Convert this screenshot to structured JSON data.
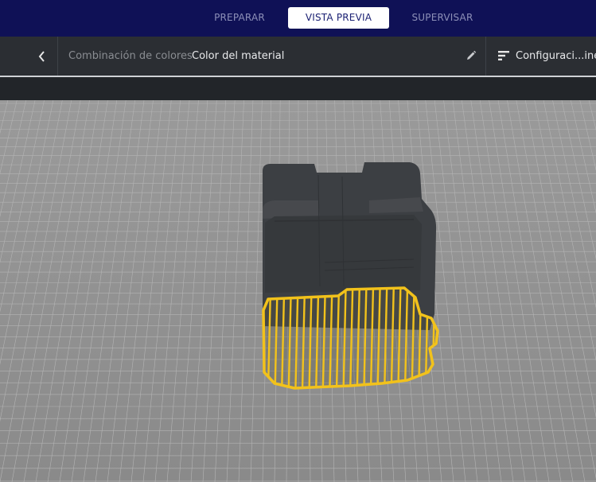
{
  "tabs": {
    "prepare": "PREPARAR",
    "preview": "VISTA PREVIA",
    "monitor": "SUPERVISAR",
    "active": "preview"
  },
  "toolbar": {
    "back_icon": "chevron-left-icon",
    "color_scheme_label": "Combinación de colores",
    "color_scheme_value": "Color del material",
    "edit_icon": "pencil-icon",
    "settings_icon": "print-settings-icon",
    "settings_label": "Configuraci...ine -"
  },
  "colors": {
    "header_bg": "#0f1156",
    "toolbar_bg": "#2b2e33",
    "build_plate": "#8f8f8f",
    "model_body": "#3c3f43",
    "layer_highlight": "#f2c21b"
  }
}
